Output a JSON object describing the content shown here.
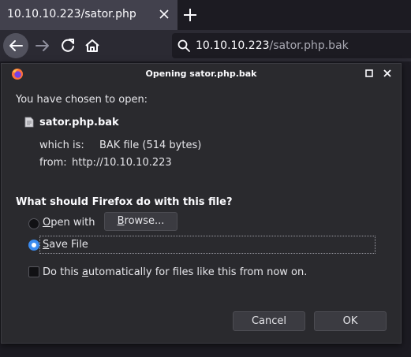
{
  "browser": {
    "tab_title": "10.10.10.223/sator.php",
    "url_host": "10.10.10.223",
    "url_path": "/sator.php.bak"
  },
  "dialog": {
    "title": "Opening sator.php.bak",
    "chosen_text": "You have chosen to open:",
    "file_name": "sator.php.bak",
    "which_is_label": "which is:",
    "which_is_value": "BAK file (514 bytes)",
    "from_label": "from:",
    "from_value": "http://10.10.10.223",
    "question": "What should Firefox do with this file?",
    "open_with": {
      "access_key": "O",
      "rest": "pen with",
      "selected": false
    },
    "browse": {
      "before": "",
      "access_key": "B",
      "rest": "rowse..."
    },
    "save_file": {
      "access_key": "S",
      "rest": "ave File",
      "selected": true
    },
    "auto": {
      "before": "Do this ",
      "access_key": "a",
      "rest": "utomatically for files like this from now on.",
      "checked": false
    },
    "cancel_label": "Cancel",
    "ok_label": "OK"
  },
  "colors": {
    "accent": "#3b8cf0",
    "dialog_bg": "#2a2a2e",
    "toolbar_bg": "#2b2a33"
  }
}
